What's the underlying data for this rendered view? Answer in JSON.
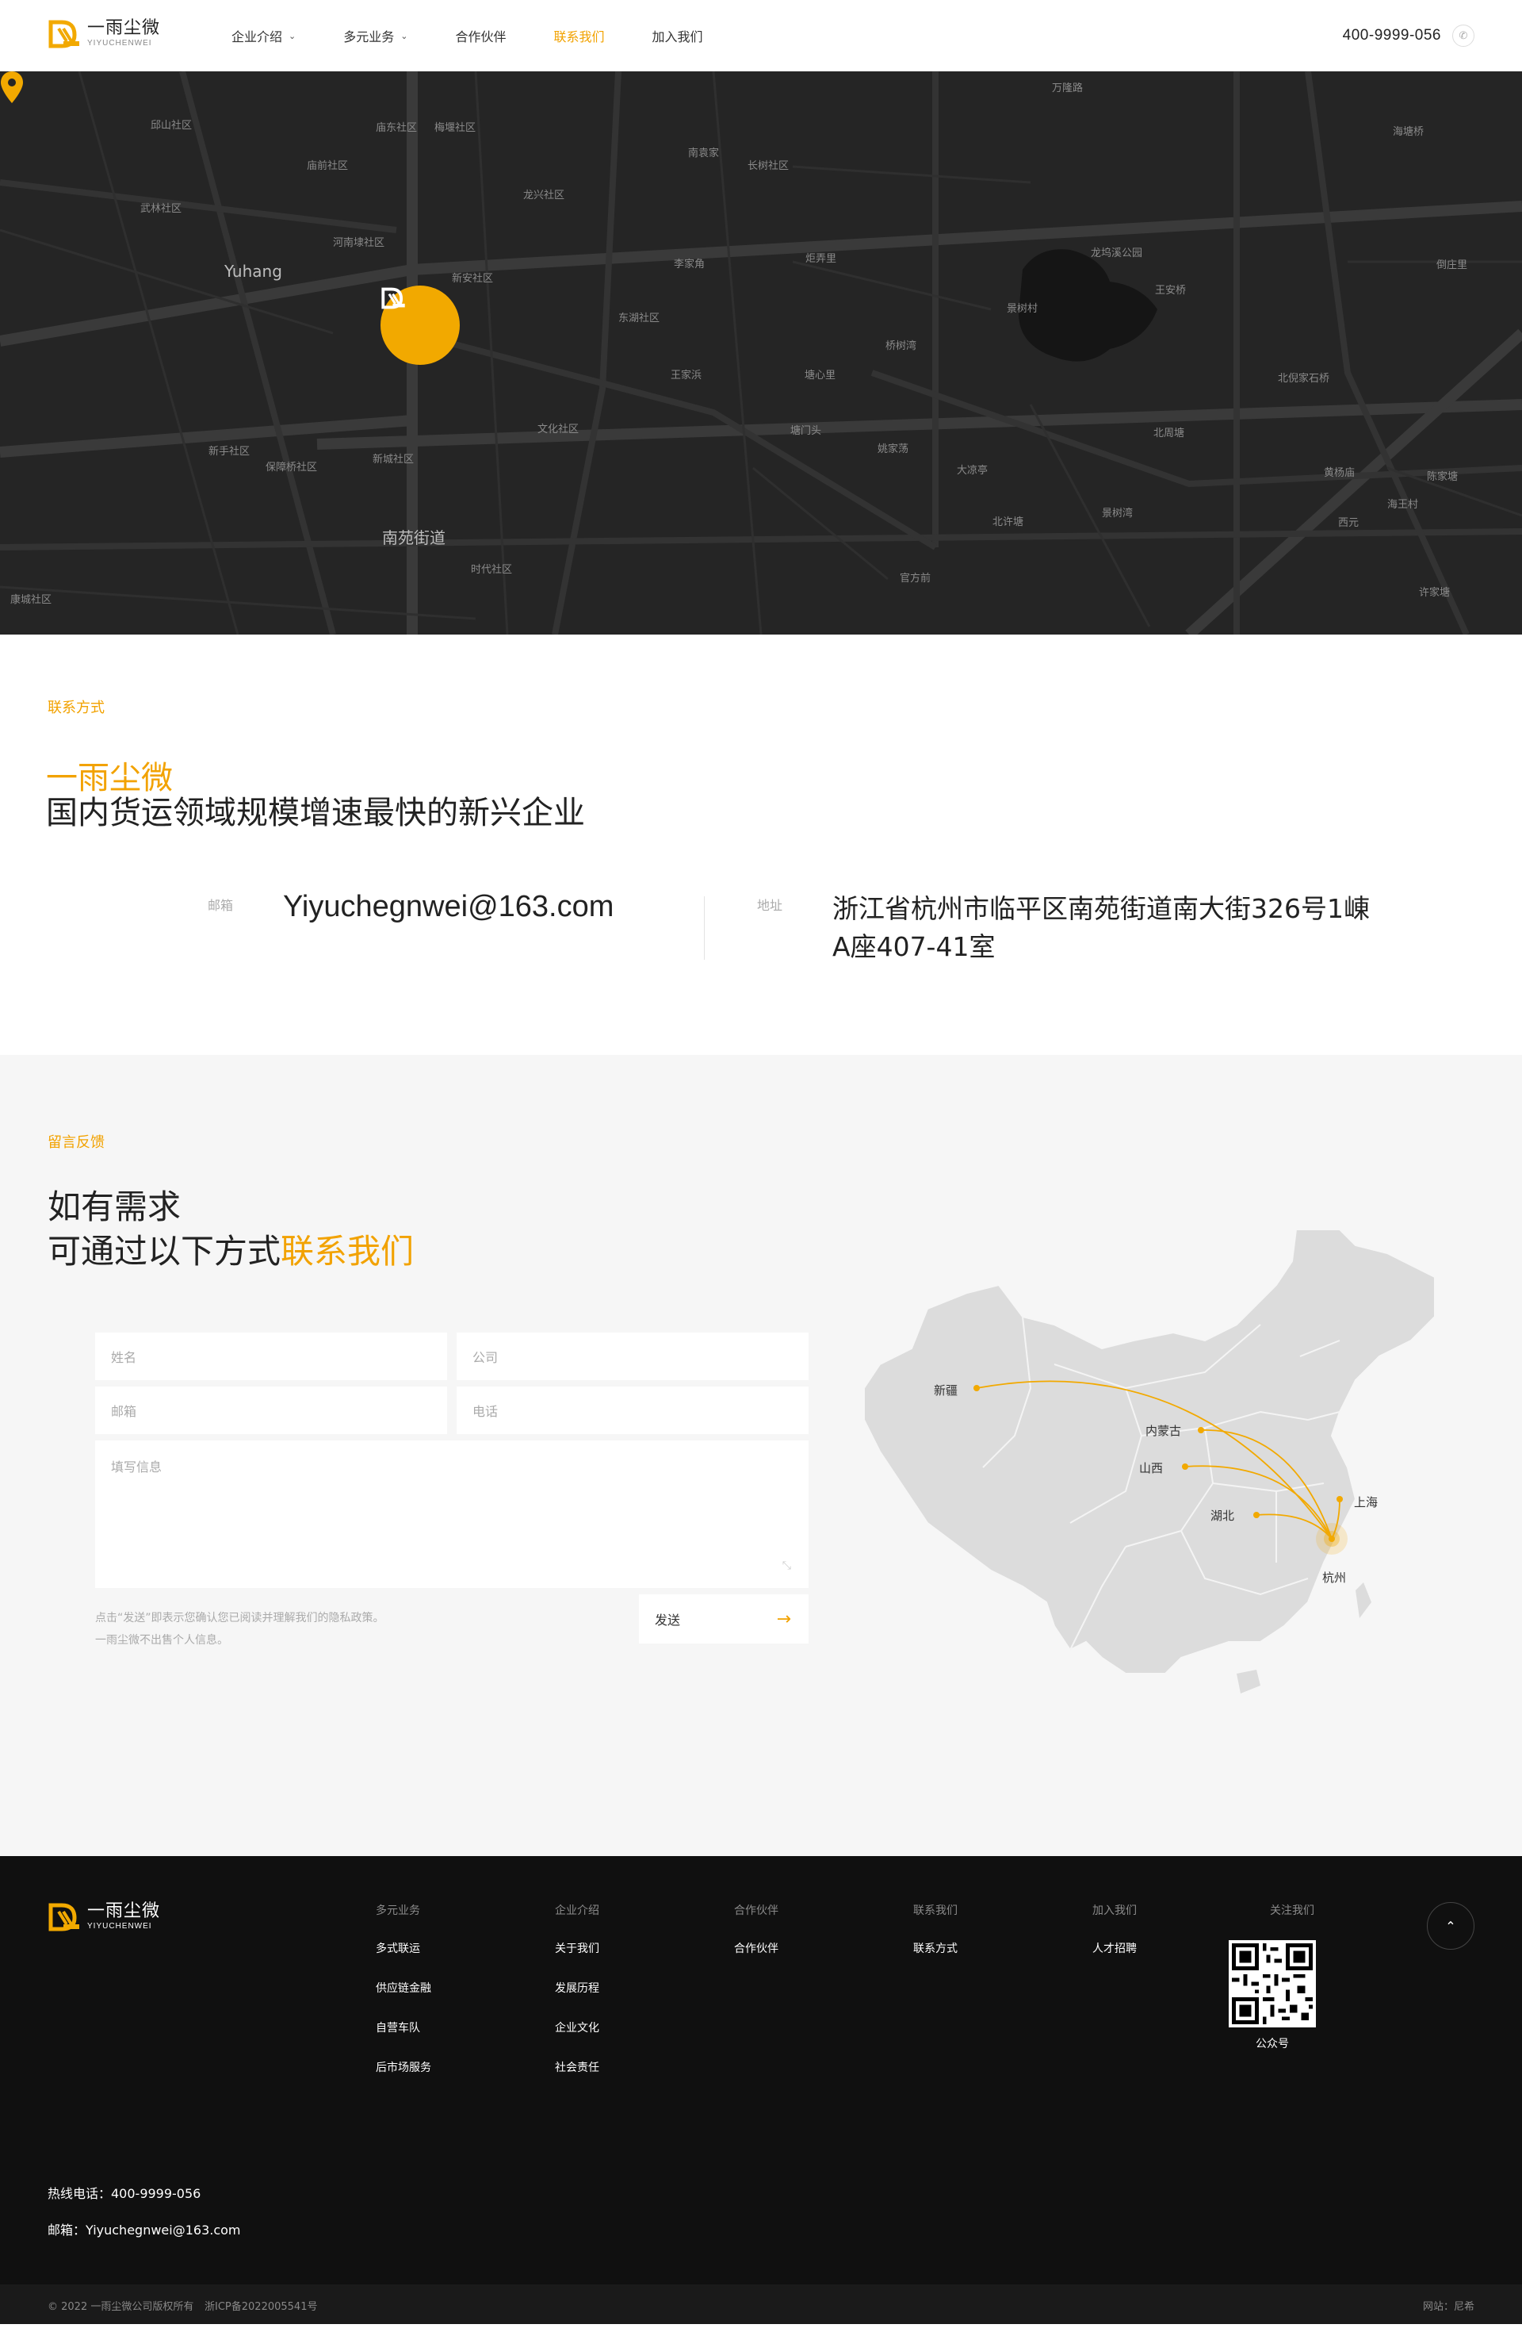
{
  "brand": {
    "name_cn": "一雨尘微",
    "name_en": "YIYUCHENWEI",
    "accent_color": "#f2a200"
  },
  "header": {
    "nav": [
      {
        "label": "企业介绍",
        "has_dropdown": true
      },
      {
        "label": "多元业务",
        "has_dropdown": true
      },
      {
        "label": "合作伙伴",
        "has_dropdown": false
      },
      {
        "label": "联系我们",
        "has_dropdown": false,
        "active": true
      },
      {
        "label": "加入我们",
        "has_dropdown": false
      }
    ],
    "phone": "400-9999-056",
    "phone_icon": "phone-icon"
  },
  "map": {
    "labels": [
      "邱山社区",
      "庙东社区",
      "梅堰社区",
      "庙前社区",
      "武林社区",
      "河南埭社区",
      "Yuhang",
      "新安社区",
      "龙兴社区",
      "南袁家",
      "长树社区",
      "李家角",
      "炬弄里",
      "东湖社区",
      "王家浜",
      "塘心里",
      "桥树湾",
      "景树村",
      "王安桥",
      "新手社区",
      "保障桥社区",
      "新城社区",
      "文化社区",
      "塘门头",
      "姚家荡",
      "大凉亭",
      "北周塘",
      "南苑街道",
      "时代社区",
      "北许塘",
      "景树湾",
      "官方前",
      "康城社区",
      "倒庄里",
      "北倪家石桥",
      "黄杨庙",
      "海王村",
      "陈家塘",
      "西元",
      "许家塘",
      "龙坞溪公园",
      "万隆路",
      "海塘桥"
    ]
  },
  "contact": {
    "eyebrow": "联系方式",
    "brand": "一雨尘微",
    "slogan": "国内货运领域规模增速最快的新兴企业",
    "email_label": "邮箱",
    "email": "Yiyuchegnwei@163.com",
    "address_label": "地址",
    "address": "浙江省杭州市临平区南苑街道南大街326号1崠A座407-41室"
  },
  "feedback": {
    "eyebrow": "留言反馈",
    "title_line1": "如有需求",
    "title_line2_plain": "可通过以下方式",
    "title_line2_highlight": "联系我们",
    "placeholders": {
      "name": "姓名",
      "company": "公司",
      "email": "邮箱",
      "phone": "电话",
      "message": "填写信息"
    },
    "note_line1": "点击“发送”即表示您确认您已阅读并理解我们的隐私政策。",
    "note_line2": "一雨尘微不出售个人信息。",
    "send_label": "发送",
    "map_points": [
      "新疆",
      "内蒙古",
      "山西",
      "湖北",
      "上海",
      "杭州"
    ]
  },
  "footer": {
    "columns": [
      {
        "title": "多元业务",
        "links": [
          "多式联运",
          "供应链金融",
          "自营车队",
          "后市场服务"
        ]
      },
      {
        "title": "企业介绍",
        "links": [
          "关于我们",
          "发展历程",
          "企业文化",
          "社会责任"
        ]
      },
      {
        "title": "合作伙伴",
        "links": [
          "合作伙伴"
        ]
      },
      {
        "title": "联系我们",
        "links": [
          "联系方式"
        ]
      },
      {
        "title": "加入我们",
        "links": [
          "人才招聘"
        ]
      }
    ],
    "follow_title": "关注我们",
    "qr_label": "公众号",
    "hotline": "热线电话：400-9999-056",
    "email": "邮箱：Yiyuchegnwei@163.com",
    "copyright": "© 2022 一雨尘微公司版权所有",
    "icp": "浙ICP备2022005541号",
    "site_credit": "网站：尼希"
  }
}
